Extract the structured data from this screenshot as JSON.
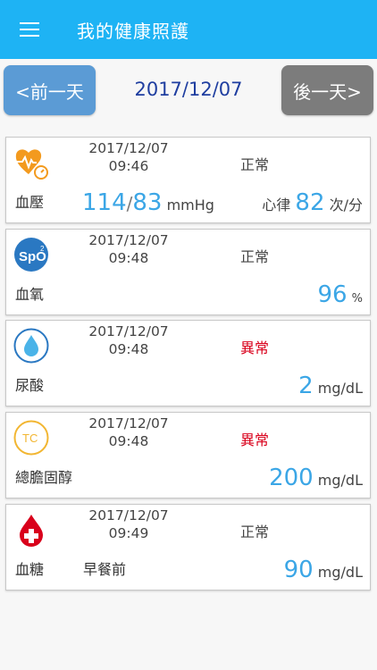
{
  "header": {
    "title": "我的健康照護"
  },
  "nav": {
    "prev_label": "<前一天",
    "date": "2017/12/07",
    "next_label": "後一天>"
  },
  "records": [
    {
      "icon": "heart-pulse-icon",
      "date": "2017/12/07",
      "time": "09:46",
      "status": "正常",
      "label": "血壓",
      "systolic": "114",
      "separator": "/",
      "diastolic": "83",
      "bp_unit": "mmHg",
      "pulse_label": "心律",
      "pulse": "82",
      "pulse_unit": "次/分"
    },
    {
      "icon": "spo2-icon",
      "icon_text": "SpO",
      "icon_sup": "2",
      "date": "2017/12/07",
      "time": "09:48",
      "status": "正常",
      "label": "血氧",
      "value": "96",
      "unit": "%"
    },
    {
      "icon": "water-drop-icon",
      "date": "2017/12/07",
      "time": "09:48",
      "status": "異常",
      "label": "尿酸",
      "value": "2",
      "unit": "mg/dL"
    },
    {
      "icon": "tc-icon",
      "icon_text": "TC",
      "date": "2017/12/07",
      "time": "09:48",
      "status": "異常",
      "label": "總膽固醇",
      "value": "200",
      "unit": "mg/dL"
    },
    {
      "icon": "blood-drop-cross-icon",
      "date": "2017/12/07",
      "time": "09:49",
      "status": "正常",
      "label": "血糖",
      "sublabel": "早餐前",
      "value": "90",
      "unit": "mg/dL"
    }
  ],
  "colors": {
    "header": "#1eb3f4",
    "prev_button": "#5b9bd5",
    "next_button": "#7c7c7c",
    "value": "#3ba6e6",
    "abnormal": "#d9001b",
    "date_title": "#1f3ea0"
  }
}
